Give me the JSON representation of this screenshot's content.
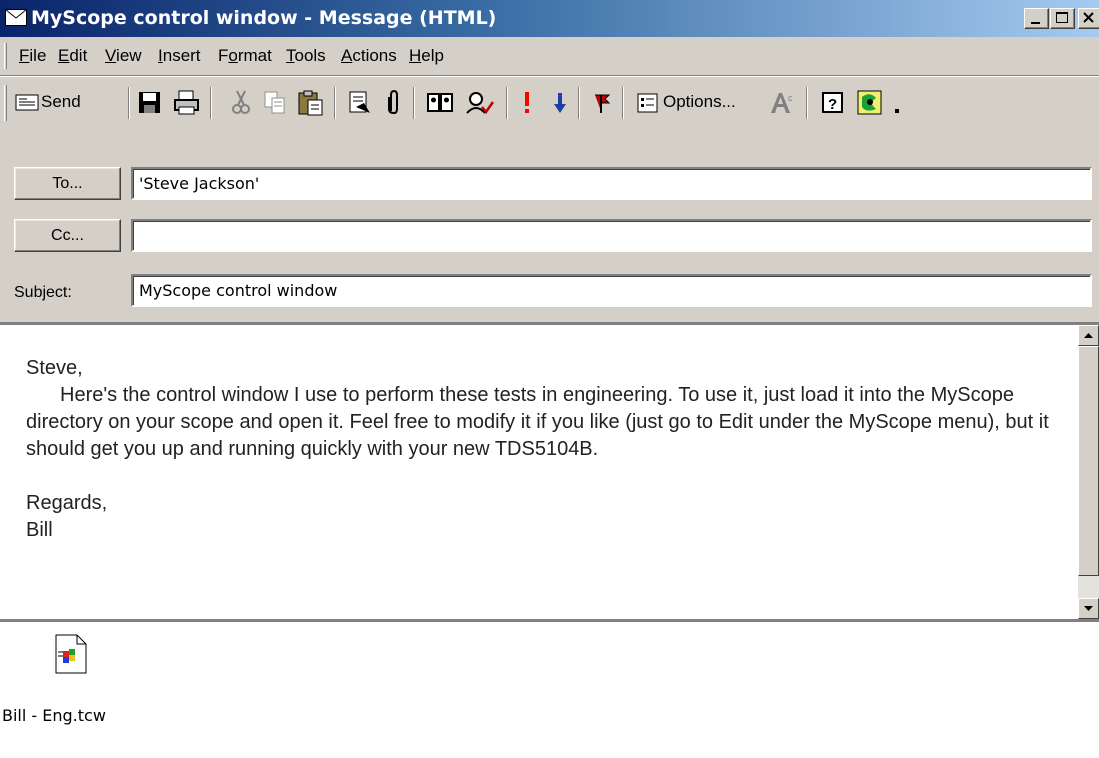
{
  "window": {
    "title": "MyScope control window - Message (HTML)",
    "controls": [
      "minimize",
      "maximize",
      "close"
    ]
  },
  "menu": [
    {
      "label": "File",
      "mnemonic_index": 0
    },
    {
      "label": "Edit",
      "mnemonic_index": 0
    },
    {
      "label": "View",
      "mnemonic_index": 0
    },
    {
      "label": "Insert",
      "mnemonic_index": 0
    },
    {
      "label": "Format",
      "mnemonic_index": 1
    },
    {
      "label": "Tools",
      "mnemonic_index": 0
    },
    {
      "label": "Actions",
      "mnemonic_index": 0
    },
    {
      "label": "Help",
      "mnemonic_index": 0
    }
  ],
  "toolbar": {
    "send_label": "Send",
    "options_label": "Options...",
    "icons": [
      "send-icon",
      "save-icon",
      "print-icon",
      "cut-icon",
      "copy-icon",
      "paste-icon",
      "insert-file-icon",
      "attach-icon",
      "address-book-icon",
      "check-names-icon",
      "importance-high-icon",
      "importance-low-icon",
      "flag-icon",
      "options-icon",
      "font-color-icon",
      "help-icon",
      "assistant-icon",
      "more-icon"
    ]
  },
  "header": {
    "to_button": "To...",
    "to_value": "'Steve Jackson'",
    "cc_button": "Cc...",
    "cc_value": "",
    "subject_label": "Subject:",
    "subject_value": "MyScope control window"
  },
  "body": {
    "greeting": "Steve,",
    "paragraph": "Here's the control window I use to perform these tests in engineering.  To use it, just load it into the MyScope directory on your scope and open it.  Feel free to modify it if you like (just go to Edit under the MyScope menu), but it should get you up and running quickly with your new TDS5104B.",
    "closing": "Regards,",
    "signature": "Bill"
  },
  "attachment": {
    "filename": "Bill - Eng.tcw"
  },
  "colors": {
    "titlebar_start": "#0a246a",
    "titlebar_end": "#a6caf0",
    "window_face": "#d4d0c8",
    "importance_high": "#ff0000",
    "importance_low": "#1f3da8"
  }
}
